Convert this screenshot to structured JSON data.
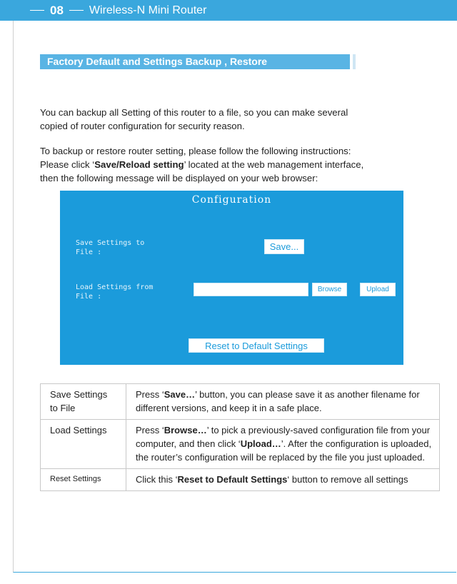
{
  "header": {
    "page_number": "08",
    "title": "Wireless-N Mini Router"
  },
  "section": {
    "title": "Factory Default  and Settings Backup , Restore"
  },
  "intro": {
    "line1": "You can backup all Setting of this router to a file, so you can make several",
    "line2": "copied of router configuration for security reason."
  },
  "instructions": {
    "line1": "To backup or restore router setting, please follow the following instructions:",
    "line2_pre": "Please click ‘",
    "line2_bold": "Save/Reload setting",
    "line2_post": "’ located at the web management interface,",
    "line3": "then the following message will be displayed on your web browser:"
  },
  "config_panel": {
    "title": "Configuration",
    "save_label_1": "Save Settings to",
    "save_label_2": "File :",
    "save_button": "Save...",
    "load_label_1": "Load Settings from",
    "load_label_2": "File :",
    "file_input_value": "",
    "browse_button": "Browse",
    "upload_button": "Upload",
    "reset_button": "Reset to Default Settings",
    "colors": {
      "panel": "#1b9bdb",
      "button_text": "#1b9bdb"
    }
  },
  "table": {
    "rows": [
      {
        "name_1": "Save Settings",
        "name_2": "to File",
        "d_pre": "Press ‘",
        "d_bold": "Save…",
        "d_post": "’ button, you can please save it as another filename for different versions, and keep it in a safe place."
      },
      {
        "name_1": "Load Settings",
        "d_pre": "Press ‘",
        "d_bold": "Browse…",
        "d_mid": "’ to pick a previously-saved configuration file from your computer, and then click ‘",
        "d_bold2": "Upload…",
        "d_post": "’. After the configuration is uploaded, the router’s configuration will be replaced by the file you just uploaded."
      },
      {
        "name_1": "Reset Settings",
        "d_pre": "Click this ‘",
        "d_bold": "Reset to Default Settings",
        "d_post": "‘ button to remove all settings"
      }
    ]
  },
  "colors": {
    "header": "#3aa7dd",
    "section_title_bg": "#59b4e4"
  }
}
